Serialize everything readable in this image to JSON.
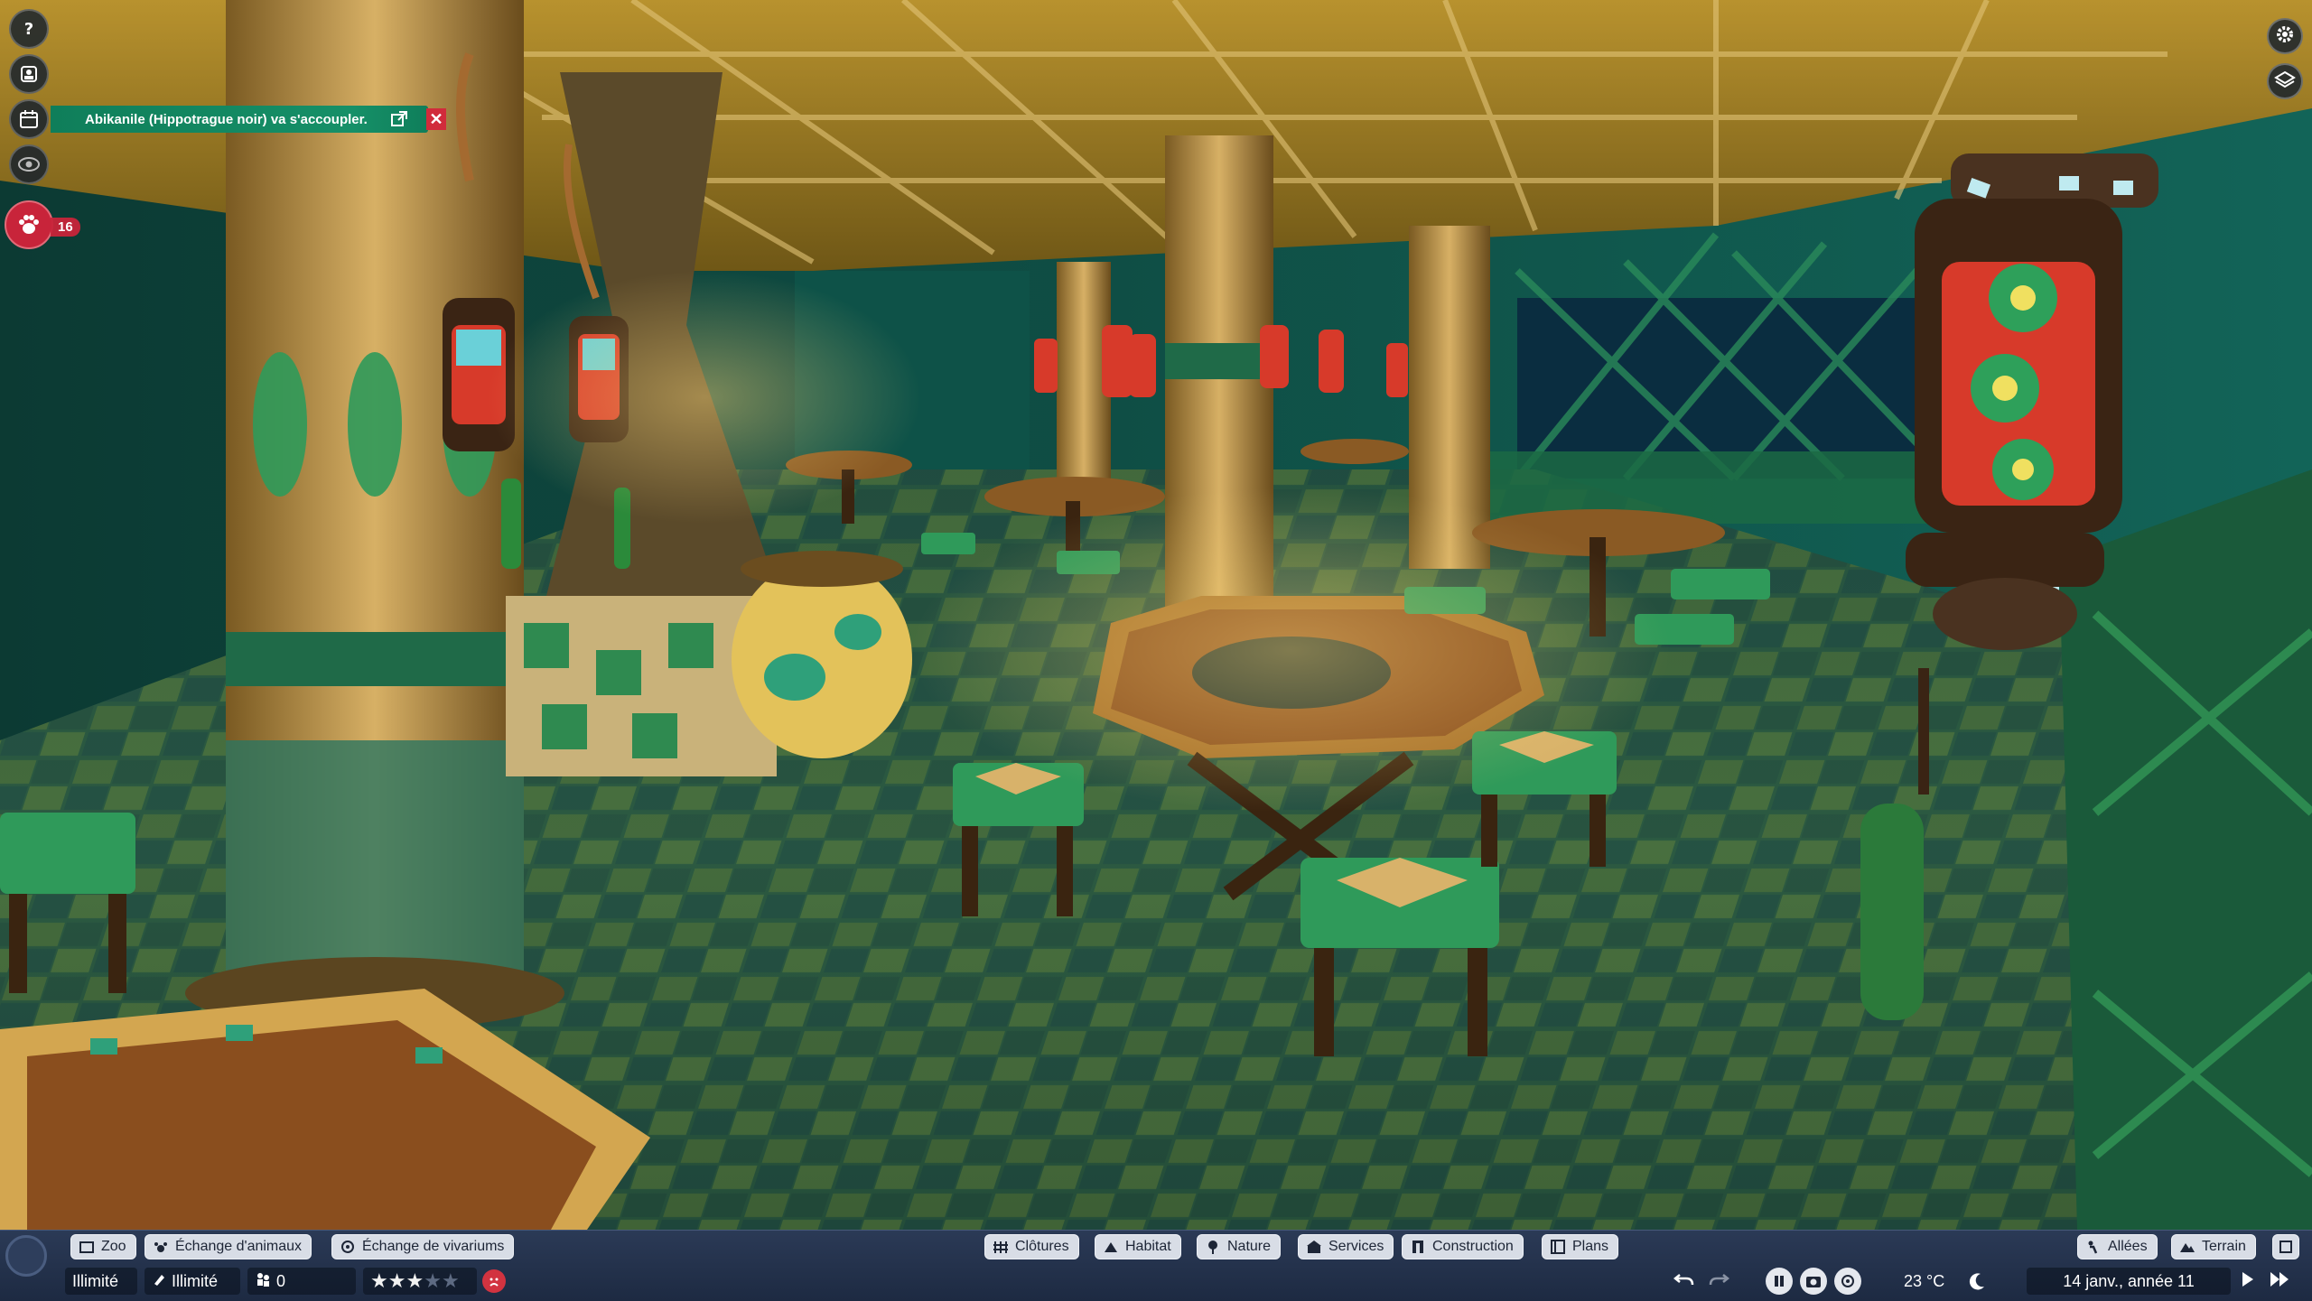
{
  "notification": {
    "text": "Abikanile (Hippotrague noir) va s'accoupler.",
    "external_icon": "external-link-icon",
    "close_icon": "close-icon",
    "calendar_icon": "calendar-icon"
  },
  "left_rail": {
    "items": [
      {
        "icon": "help-icon"
      },
      {
        "icon": "zookeeper-icon"
      },
      {
        "icon": "calendar-icon"
      },
      {
        "icon": "view-icon"
      },
      {
        "icon": "paw-icon"
      }
    ],
    "animal_badge_count": "16"
  },
  "right_top": {
    "items": [
      {
        "icon": "settings-gear-icon"
      },
      {
        "icon": "layers-icon"
      }
    ]
  },
  "bottom_toolbar": {
    "left_tabs": [
      {
        "label": "Zoo",
        "icon": "zoo-icon"
      },
      {
        "label": "Échange d'animaux",
        "icon": "animal-trade-icon"
      },
      {
        "label": "Échange de vivariums",
        "icon": "vivarium-trade-icon"
      }
    ],
    "center_tabs": [
      {
        "label": "Clôtures",
        "icon": "fence-icon"
      },
      {
        "label": "Habitat",
        "icon": "habitat-icon"
      },
      {
        "label": "Nature",
        "icon": "nature-icon"
      },
      {
        "label": "Services",
        "icon": "services-icon"
      },
      {
        "label": "Construction",
        "icon": "construction-icon"
      },
      {
        "label": "Plans",
        "icon": "blueprint-icon"
      }
    ],
    "right_tabs": [
      {
        "label": "Allées",
        "icon": "path-icon"
      },
      {
        "label": "Terrain",
        "icon": "terrain-icon"
      }
    ]
  },
  "status_bar": {
    "money": "Illimité",
    "research": "Illimité",
    "guests": "0",
    "rating_stars": 3,
    "rating_max": 5,
    "temperature": "23 °C",
    "date": "14 janv., année 11"
  },
  "colors": {
    "notification_bg": "#169068",
    "alert_red": "#c8243a",
    "toolbar_bg": "#24334e",
    "pill_bg": "#d8dde6"
  }
}
